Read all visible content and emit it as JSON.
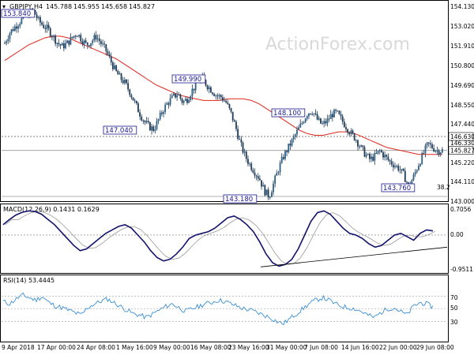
{
  "chart_data": [
    {
      "type": "candlestick",
      "title": "GBPJPY,H4",
      "ohlc": [
        "145.788",
        "145.955",
        "145.658",
        "145.827"
      ],
      "watermark": "ActionForex.com",
      "ylim": [
        143.0,
        154.3
      ],
      "yticks": [
        "154.130",
        "153.020",
        "151.910",
        "150.800",
        "149.690",
        "148.550",
        "147.440",
        "146.330",
        "145.220",
        "144.110",
        "143.000"
      ],
      "price_badges": [
        "146.630",
        "145.827"
      ],
      "level_labels": [
        "153.840",
        "149.990",
        "147.040",
        "148.100",
        "143.180",
        "143.760"
      ],
      "fib_label": "38.2",
      "close_series": [
        152.0,
        152.6,
        152.9,
        153.2,
        153.5,
        153.7,
        153.84,
        153.3,
        153.0,
        152.8,
        152.4,
        152.0,
        151.8,
        152.0,
        152.3,
        152.6,
        152.2,
        151.9,
        152.1,
        152.4,
        152.0,
        151.6,
        151.0,
        150.4,
        150.0,
        149.7,
        149.2,
        148.6,
        148.0,
        147.5,
        147.2,
        147.04,
        147.6,
        148.2,
        148.6,
        148.9,
        149.1,
        148.6,
        148.8,
        149.3,
        149.7,
        149.99,
        149.6,
        149.3,
        149.0,
        148.9,
        148.6,
        148.0,
        147.2,
        146.2,
        145.5,
        145.0,
        144.6,
        144.2,
        143.5,
        143.18,
        144.0,
        144.8,
        145.5,
        146.0,
        146.5,
        147.0,
        147.5,
        148.0,
        148.1,
        147.6,
        147.3,
        147.5,
        147.9,
        148.0,
        147.6,
        147.2,
        146.8,
        146.5,
        146.0,
        145.6,
        145.3,
        145.5,
        145.8,
        145.5,
        145.2,
        145.0,
        144.8,
        144.4,
        143.76,
        144.3,
        145.0,
        145.6,
        146.2,
        146.0,
        145.8,
        145.83
      ],
      "ma_series": [
        151.0,
        151.3,
        151.6,
        151.9,
        152.1,
        152.3,
        152.4,
        152.4,
        152.3,
        152.1,
        151.9,
        151.7,
        151.5,
        151.3,
        151.1,
        150.8,
        150.5,
        150.2,
        149.9,
        149.6,
        149.4,
        149.2,
        149.0,
        148.9,
        148.8,
        148.7,
        148.7,
        148.7,
        148.8,
        148.8,
        148.8,
        148.7,
        148.5,
        148.2,
        147.9,
        147.6,
        147.3,
        147.0,
        146.8,
        146.7,
        146.7,
        146.8,
        146.9,
        146.9,
        146.8,
        146.6,
        146.4,
        146.2,
        146.0,
        145.9,
        145.8,
        145.7,
        145.6,
        145.6,
        145.6,
        145.6
      ],
      "x_labels": [
        "9 Apr 2018",
        "17 Apr 00:00",
        "24 Apr 08:00",
        "1 May 16:00",
        "9 May 00:00",
        "16 May 08:00",
        "23 May 16:00",
        "31 May 00:00",
        "7 Jun 08:00",
        "14 Jun 16:00",
        "22 Jun 00:00",
        "29 Jun 08:00"
      ]
    },
    {
      "type": "line",
      "title": "MACD(12,26,9) 0.1431 0.1629",
      "ylim": [
        -1.05,
        0.82
      ],
      "yticks": [
        "0.7056",
        "0.00",
        "-0.9511"
      ],
      "macd": [
        0.3,
        0.45,
        0.58,
        0.66,
        0.7,
        0.68,
        0.6,
        0.45,
        0.3,
        0.1,
        -0.1,
        -0.3,
        -0.45,
        -0.4,
        -0.25,
        -0.1,
        0.05,
        0.15,
        0.25,
        0.3,
        0.2,
        0.0,
        -0.2,
        -0.45,
        -0.65,
        -0.75,
        -0.7,
        -0.55,
        -0.35,
        -0.1,
        0.0,
        0.05,
        0.1,
        0.2,
        0.35,
        0.5,
        0.55,
        0.45,
        0.3,
        0.1,
        -0.2,
        -0.55,
        -0.8,
        -0.9,
        -0.85,
        -0.7,
        -0.4,
        0.0,
        0.4,
        0.65,
        0.7,
        0.6,
        0.4,
        0.2,
        0.05,
        0.0,
        -0.1,
        -0.25,
        -0.35,
        -0.3,
        -0.15,
        0.0,
        0.05,
        -0.05,
        -0.15,
        0.05,
        0.15,
        0.12
      ],
      "trendline": [
        [
          -0.92,
          -0.35
        ]
      ]
    },
    {
      "type": "line",
      "title": "RSI(14) 53.4445",
      "ylim": [
        0,
        100
      ],
      "yticks": [
        "70",
        "50",
        "30"
      ],
      "rsi": [
        62,
        58,
        66,
        72,
        68,
        64,
        70,
        60,
        55,
        52,
        48,
        44,
        40,
        52,
        58,
        62,
        66,
        60,
        54,
        48,
        42,
        40,
        36,
        42,
        48,
        54,
        58,
        52,
        46,
        50,
        54,
        58,
        60,
        64,
        62,
        58,
        54,
        50,
        48,
        44,
        40,
        36,
        30,
        26,
        34,
        42,
        50,
        58,
        64,
        68,
        64,
        58,
        54,
        52,
        50,
        46,
        40,
        36,
        44,
        50,
        52,
        46,
        40,
        54,
        60,
        58,
        53
      ]
    }
  ]
}
